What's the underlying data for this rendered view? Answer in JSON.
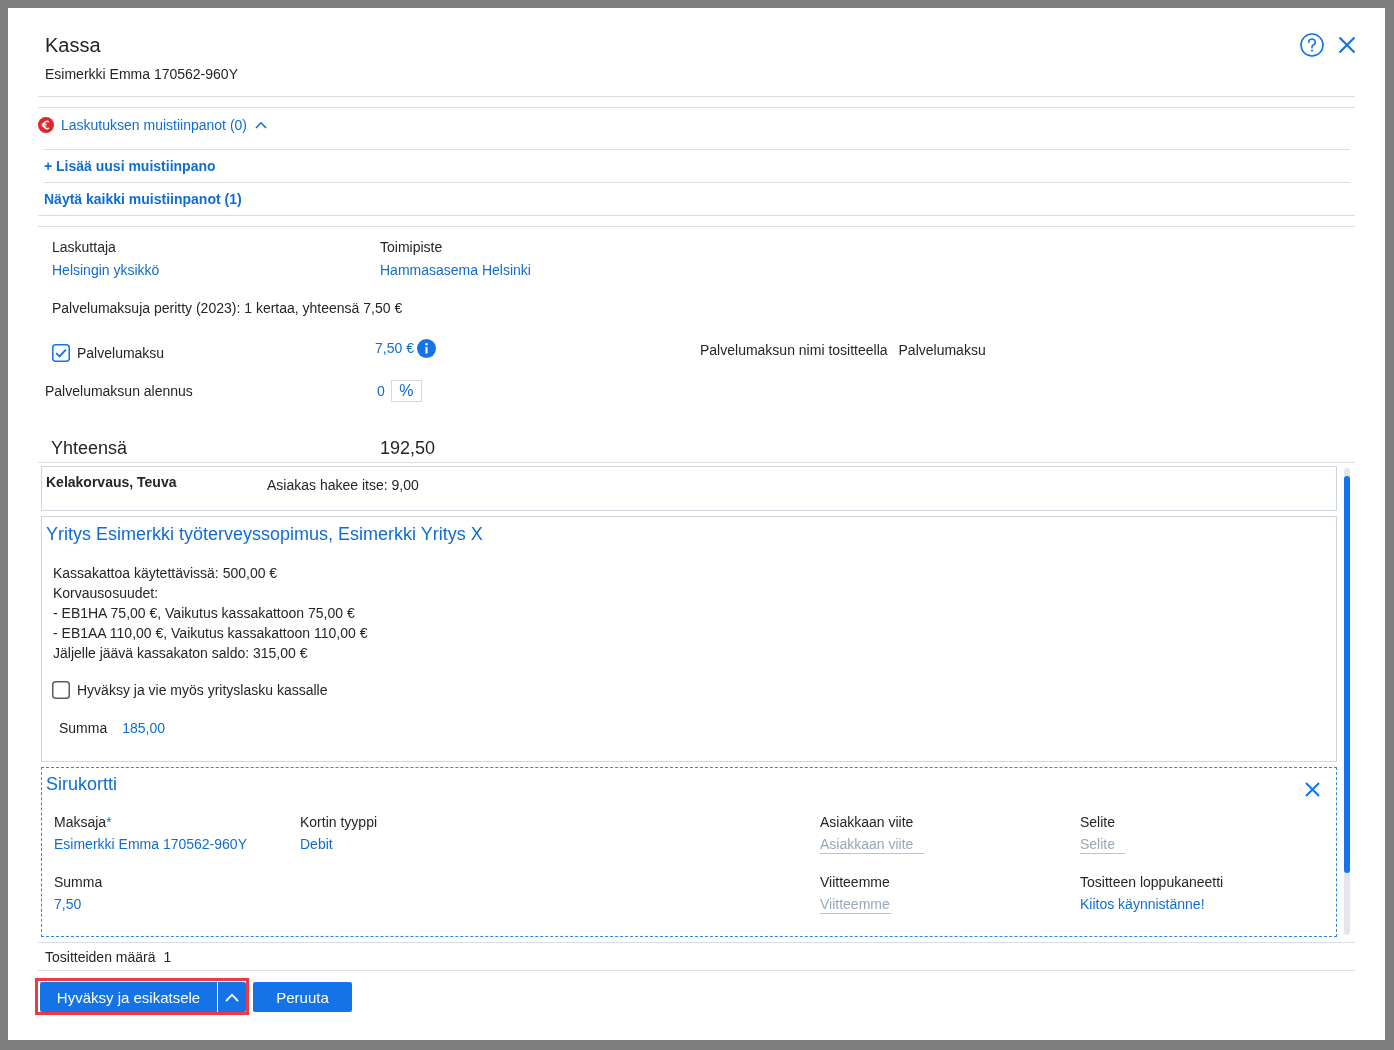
{
  "dialog": {
    "title": "Kassa",
    "subtitle": "Esimerkki Emma 170562-960Y"
  },
  "billing_notes": {
    "label": "Laskutuksen muistiinpanot (0)",
    "expanded": true,
    "actions": [
      "+ Lisää uusi muistiinpano",
      "Näytä kaikki muistiinpanot (1)"
    ]
  },
  "billing": {
    "fields": [
      {
        "label": "Laskuttaja",
        "value": "Helsingin yksikkö"
      },
      {
        "label": "Toimipiste",
        "value": "Hammasasema Helsinki"
      }
    ],
    "fees_note": "Palvelumaksuja peritty (2023): 1 kertaa, yhteensä 7,50 €",
    "service_fee": {
      "label": "Palvelumaksu",
      "checked": true,
      "amount": "7,50 €",
      "name_label": "Palvelumaksun nimi tositteella",
      "name_value": "Palvelumaksu"
    },
    "discount": {
      "label": "Palvelumaksun alennus",
      "value": "0",
      "unit": "%"
    },
    "total": {
      "label": "Yhteensä",
      "value": "192,50"
    }
  },
  "payments": [
    {
      "kind": "benefit",
      "title": "Kelakorvaus, Teuva",
      "detail": "Asiakas hakee itse: 9,00"
    },
    {
      "kind": "contract",
      "title": "Yritys Esimerkki työterveyssopimus, Esimerkki Yritys X",
      "lines": [
        "Kassakattoa käytettävissä: 500,00 €",
        "Korvausosuudet:",
        "- EB1HA 75,00 €, Vaikutus kassakattoon 75,00 €",
        "- EB1AA 110,00 €, Vaikutus kassakattoon 110,00 €",
        "Jäljelle jäävä kassakaton saldo: 315,00 €"
      ],
      "approve": {
        "label": "Hyväksy ja vie myös yrityslasku kassalle",
        "checked": false
      },
      "sum_label": "Summa",
      "sum_value": "185,00"
    },
    {
      "kind": "card",
      "title": "Sirukortti",
      "rows": [
        {
          "left": [
            {
              "label": "Maksaja",
              "required_mark": "*",
              "value": "Esimerkki Emma 170562-960Y"
            },
            {
              "label": "Kortin tyyppi",
              "value": "Debit"
            }
          ],
          "right": [
            {
              "label": "Asiakkaan viite",
              "placeholder": "Asiakkaan viite"
            },
            {
              "label": "Selite",
              "placeholder": "Selite"
            }
          ]
        },
        {
          "left": [
            {
              "label": "Summa",
              "value": "7,50"
            }
          ],
          "right": [
            {
              "label": "Viitteemme",
              "placeholder": "Viitteemme"
            },
            {
              "label": "Tositteen loppukaneetti",
              "value": "Kiitos käynnistänne!"
            }
          ]
        }
      ]
    }
  ],
  "voucher_count": {
    "label": "Tositteiden määrä",
    "value": "1"
  },
  "buttons": [
    {
      "kind": "split",
      "label": "Hyväksy ja esikatsele",
      "highlighted": true
    },
    {
      "kind": "plain",
      "label": "Peruuta",
      "highlighted": false
    }
  ]
}
